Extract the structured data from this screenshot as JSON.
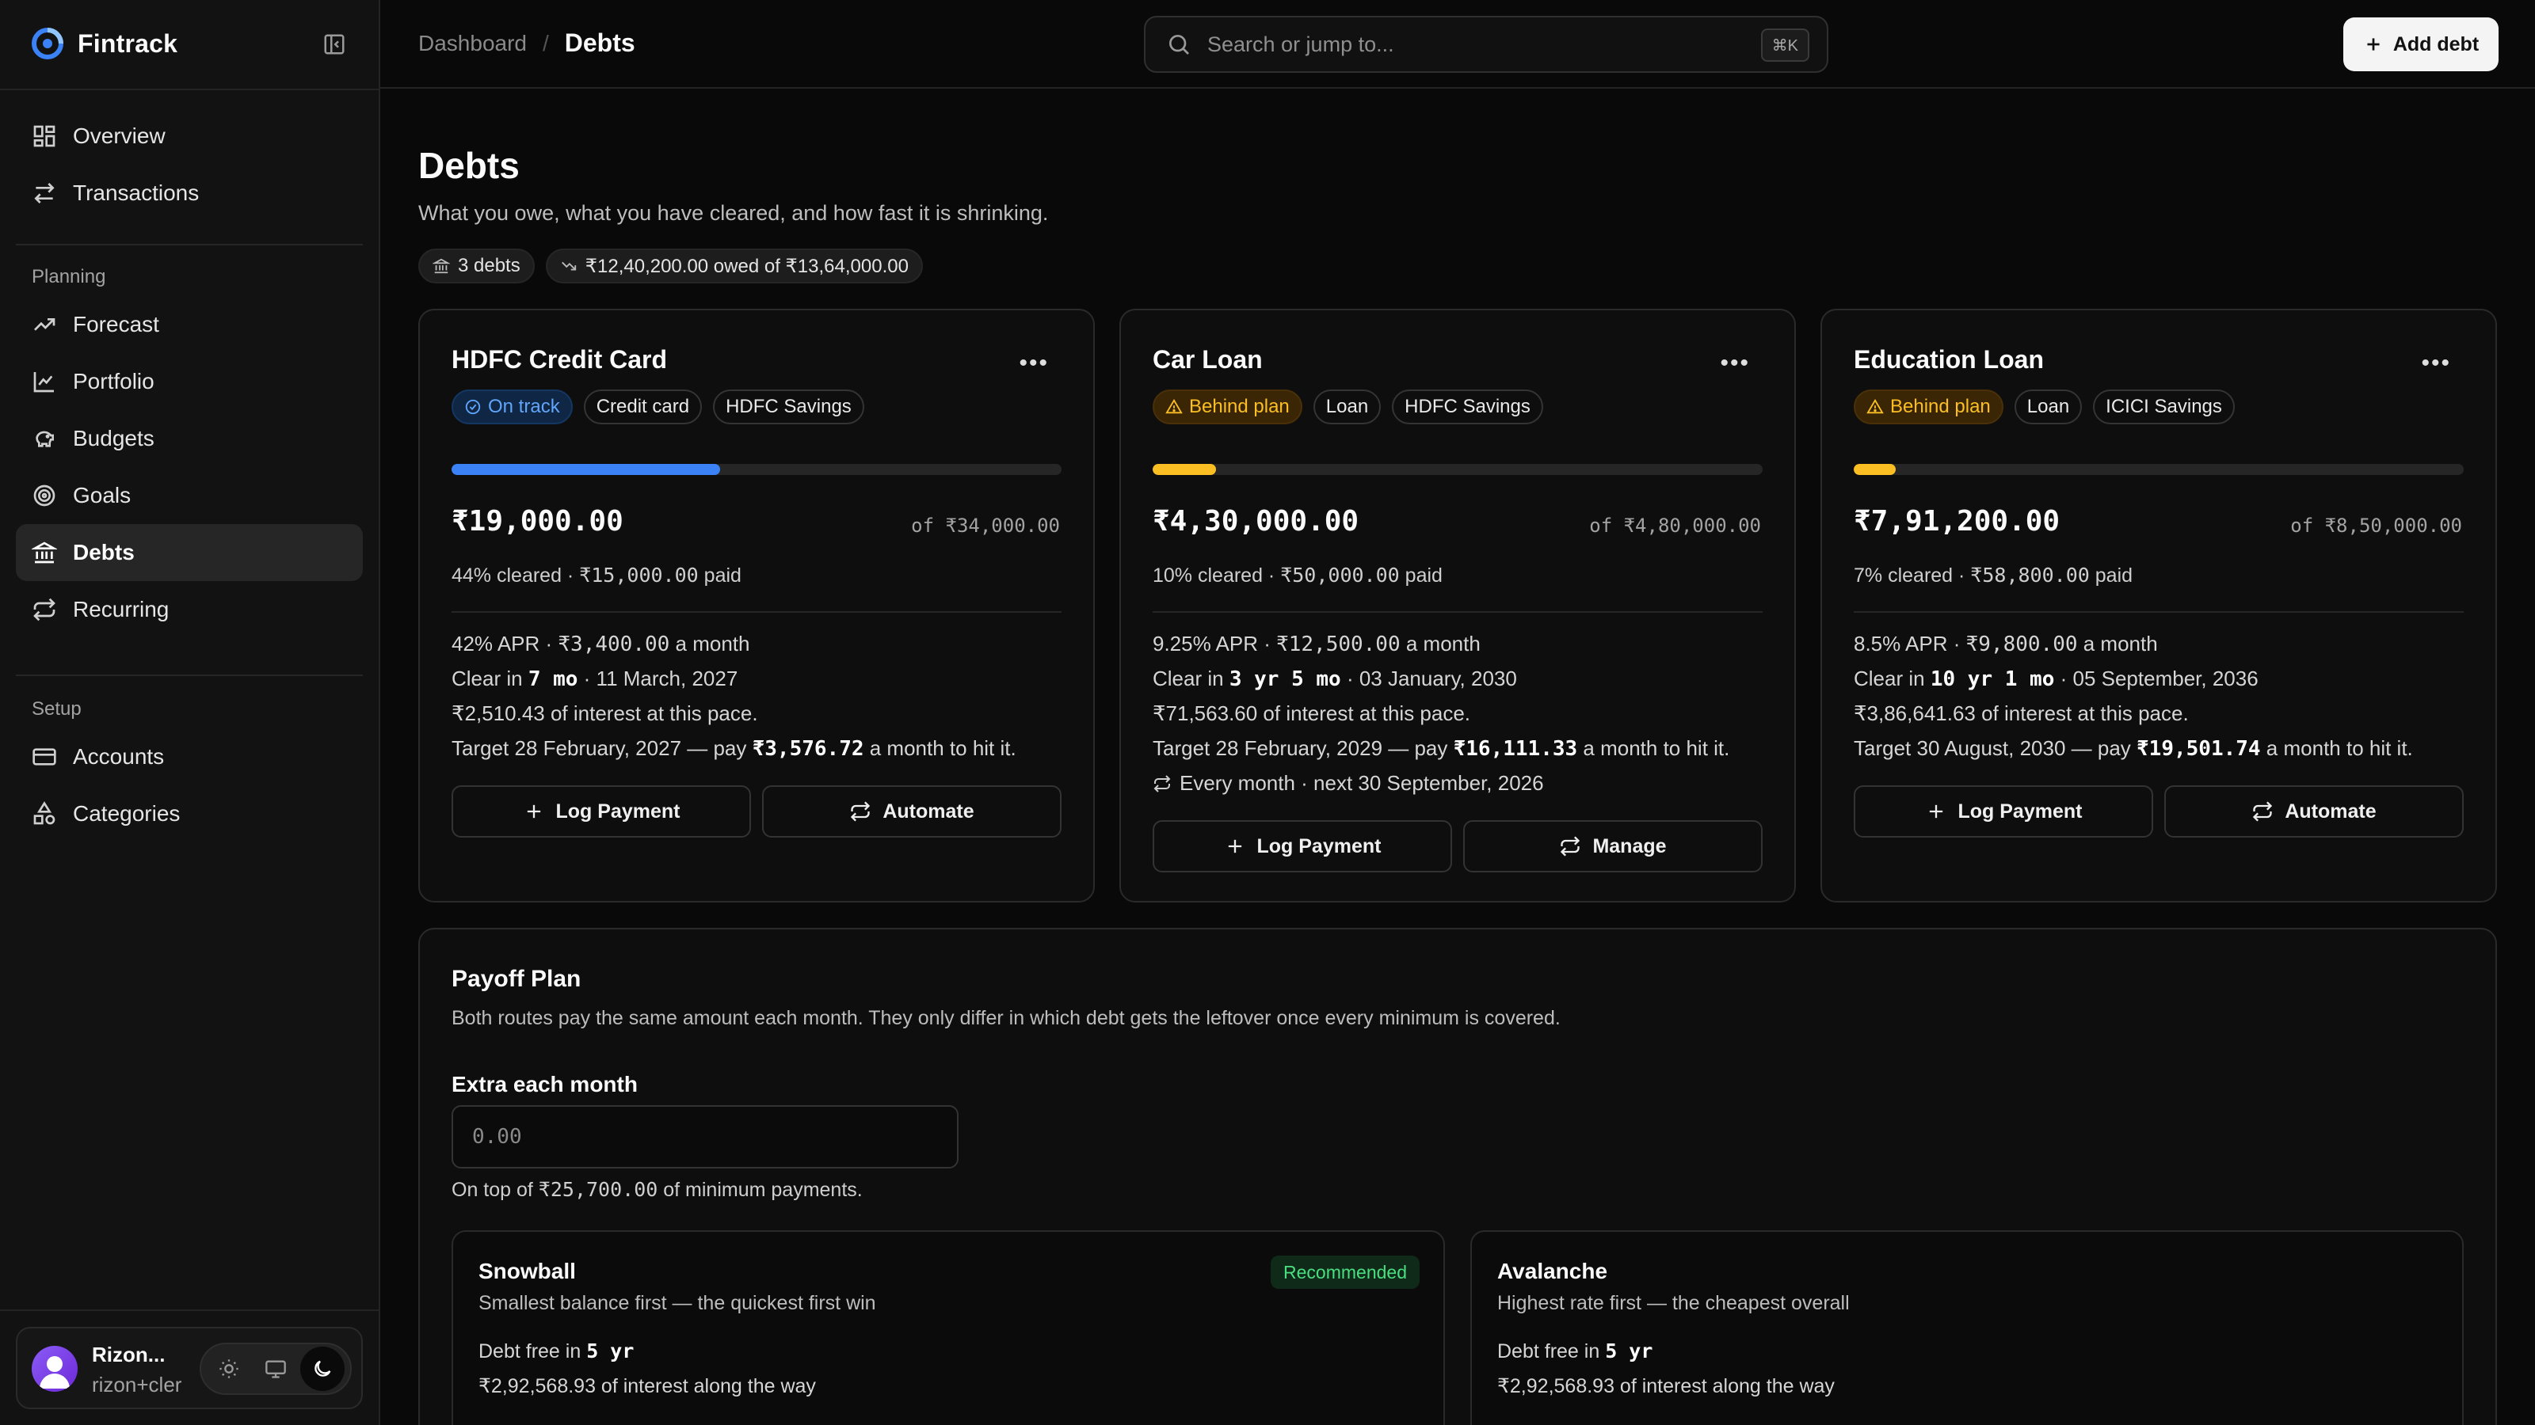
{
  "app": {
    "name": "Fintrack"
  },
  "sidebar": {
    "main_items": [
      {
        "label": "Overview"
      },
      {
        "label": "Transactions"
      }
    ],
    "planning_label": "Planning",
    "planning_items": [
      {
        "label": "Forecast"
      },
      {
        "label": "Portfolio"
      },
      {
        "label": "Budgets"
      },
      {
        "label": "Goals"
      },
      {
        "label": "Debts"
      },
      {
        "label": "Recurring"
      }
    ],
    "setup_label": "Setup",
    "setup_items": [
      {
        "label": "Accounts"
      },
      {
        "label": "Categories"
      }
    ],
    "user": {
      "name": "Rizon...",
      "email": "rizon+cler"
    }
  },
  "topbar": {
    "breadcrumb_parent": "Dashboard",
    "breadcrumb_sep": "/",
    "breadcrumb_current": "Debts",
    "search_placeholder": "Search or jump to...",
    "search_shortcut": "⌘K",
    "add_label": "Add debt"
  },
  "page": {
    "title": "Debts",
    "subtitle": "What you owe, what you have cleared, and how fast it is shrinking.",
    "debt_count": "3 debts",
    "owed_summary": "₹12,40,200.00 owed of ₹13,64,000.00"
  },
  "cards": [
    {
      "title": "HDFC Credit Card",
      "status": "On track",
      "type": "Credit card",
      "account": "HDFC Savings",
      "progress": 0.44,
      "bar_color": "#3b82f6",
      "remaining": "₹19,000.00",
      "total": "of ₹34,000.00",
      "cleared_pct": "44% cleared · ",
      "paid": "₹15,000.00",
      "paid_suffix": " paid",
      "apr_line_a": "42% APR · ",
      "apr_monthly": "₹3,400.00",
      "apr_line_b": " a month",
      "clear_prefix": "Clear in ",
      "clear_in": "7 mo",
      "clear_date": " · 11 March, 2027",
      "interest": "₹2,510.43 of interest at this pace.",
      "target_prefix": "Target 28 February, 2027 — pay ",
      "target_amount": "₹3,576.72",
      "target_suffix": " a month to hit it.",
      "btn_primary": "Log Payment",
      "btn_secondary": "Automate"
    },
    {
      "title": "Car Loan",
      "status": "Behind plan",
      "type": "Loan",
      "account": "HDFC Savings",
      "progress": 0.104,
      "bar_color": "#fbbf24",
      "remaining": "₹4,30,000.00",
      "total": "of ₹4,80,000.00",
      "cleared_pct": "10% cleared · ",
      "paid": "₹50,000.00",
      "paid_suffix": " paid",
      "apr_line_a": "9.25% APR · ",
      "apr_monthly": "₹12,500.00",
      "apr_line_b": " a month",
      "clear_prefix": "Clear in ",
      "clear_in": "3 yr 5 mo",
      "clear_date": " · 03 January, 2030",
      "interest": "₹71,563.60 of interest at this pace.",
      "target_prefix": "Target 28 February, 2029 — pay ",
      "target_amount": "₹16,111.33",
      "target_suffix": " a month to hit it.",
      "recurring": "Every month · next 30 September, 2026",
      "btn_primary": "Log Payment",
      "btn_secondary": "Manage"
    },
    {
      "title": "Education Loan",
      "status": "Behind plan",
      "type": "Loan",
      "account": "ICICI Savings",
      "progress": 0.069,
      "bar_color": "#fbbf24",
      "remaining": "₹7,91,200.00",
      "total": "of ₹8,50,000.00",
      "cleared_pct": "7% cleared · ",
      "paid": "₹58,800.00",
      "paid_suffix": " paid",
      "apr_line_a": "8.5% APR · ",
      "apr_monthly": "₹9,800.00",
      "apr_line_b": " a month",
      "clear_prefix": "Clear in ",
      "clear_in": "10 yr 1 mo",
      "clear_date": " · 05 September, 2036",
      "interest": "₹3,86,641.63 of interest at this pace.",
      "target_prefix": "Target 30 August, 2030 — pay ",
      "target_amount": "₹19,501.74",
      "target_suffix": " a month to hit it.",
      "btn_primary": "Log Payment",
      "btn_secondary": "Automate"
    }
  ],
  "plan": {
    "title": "Payoff Plan",
    "subtitle": "Both routes pay the same amount each month. They only differ in which debt gets the leftover once every minimum is covered.",
    "extra_label": "Extra each month",
    "extra_placeholder": "0.00",
    "note_prefix": "On top of ",
    "note_amount": "₹25,700.00",
    "note_suffix": " of minimum payments.",
    "snowball": {
      "title": "Snowball",
      "badge": "Recommended",
      "subtitle": "Smallest balance first — the quickest first win",
      "free_prefix": "Debt free in ",
      "free_in": "5 yr",
      "interest": "₹2,92,568.93 of interest along the way"
    },
    "avalanche": {
      "title": "Avalanche",
      "subtitle": "Highest rate first — the cheapest overall",
      "free_prefix": "Debt free in ",
      "free_in": "5 yr",
      "interest": "₹2,92,568.93 of interest along the way"
    }
  }
}
